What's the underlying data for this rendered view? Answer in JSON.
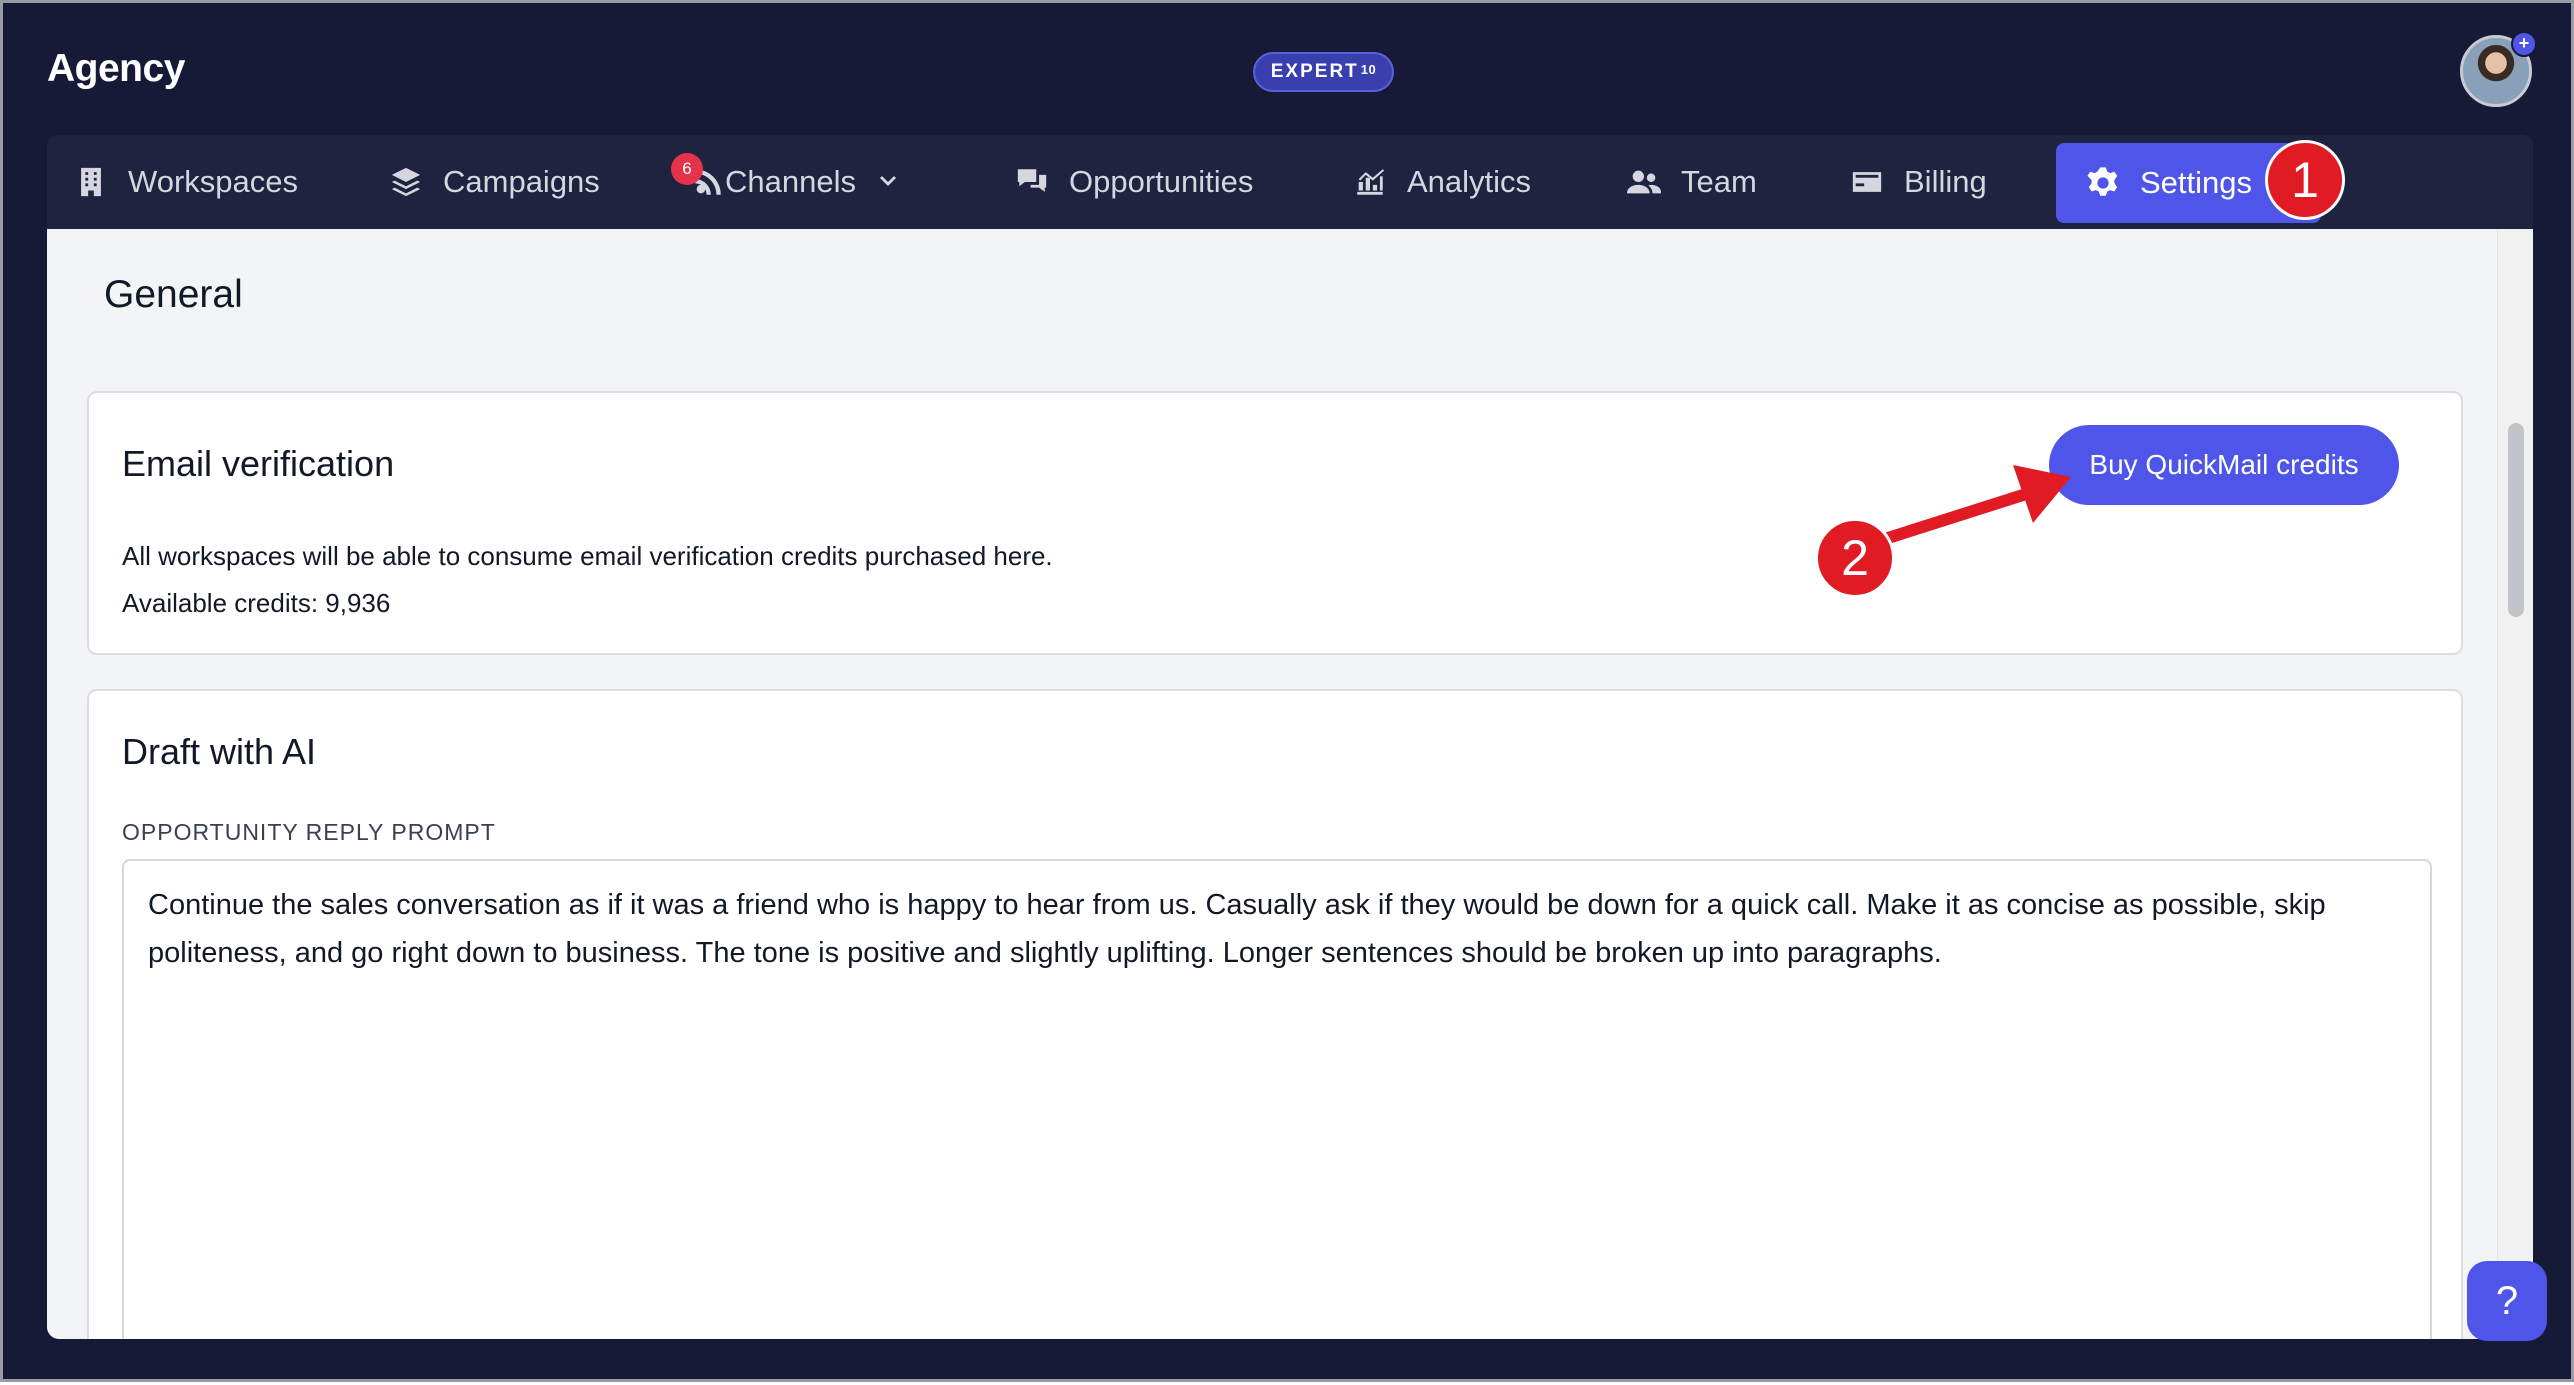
{
  "header": {
    "app_title": "Agency",
    "plan_badge": "EXPERT",
    "plan_badge_sup": "10"
  },
  "nav": {
    "items": [
      {
        "label": "Workspaces",
        "icon": "building-icon"
      },
      {
        "label": "Campaigns",
        "icon": "layers-icon"
      },
      {
        "label": "Channels",
        "icon": "rss-icon",
        "badge": "6"
      },
      {
        "label": "Opportunities",
        "icon": "chat-bubbles-icon"
      },
      {
        "label": "Analytics",
        "icon": "chart-icon"
      },
      {
        "label": "Team",
        "icon": "users-icon"
      },
      {
        "label": "Billing",
        "icon": "credit-card-icon"
      },
      {
        "label": "Settings",
        "icon": "gear-icon",
        "active": true
      }
    ]
  },
  "page": {
    "section_title": "General"
  },
  "email_verification": {
    "title": "Email verification",
    "description": "All workspaces will be able to consume email verification credits purchased here.",
    "available_credits": "Available credits: 9,936",
    "button_label": "Buy QuickMail credits"
  },
  "draft_ai": {
    "title": "Draft with AI",
    "field_label": "OPPORTUNITY REPLY PROMPT",
    "prompt_value": "Continue the sales conversation as if it was a friend who is happy to hear from us. Casually ask if they would be down for a quick call. Make it as concise as possible, skip politeness, and go right down to business. The tone is positive and slightly uplifting. Longer sentences should be broken up into paragraphs."
  },
  "annotations": {
    "step1": "1",
    "step2": "2"
  },
  "help": {
    "label": "?"
  },
  "colors": {
    "nav_bg": "#171a36",
    "accent": "#4f55e8",
    "annotation_red": "#e01b24",
    "content_bg": "#f3f4f6"
  }
}
